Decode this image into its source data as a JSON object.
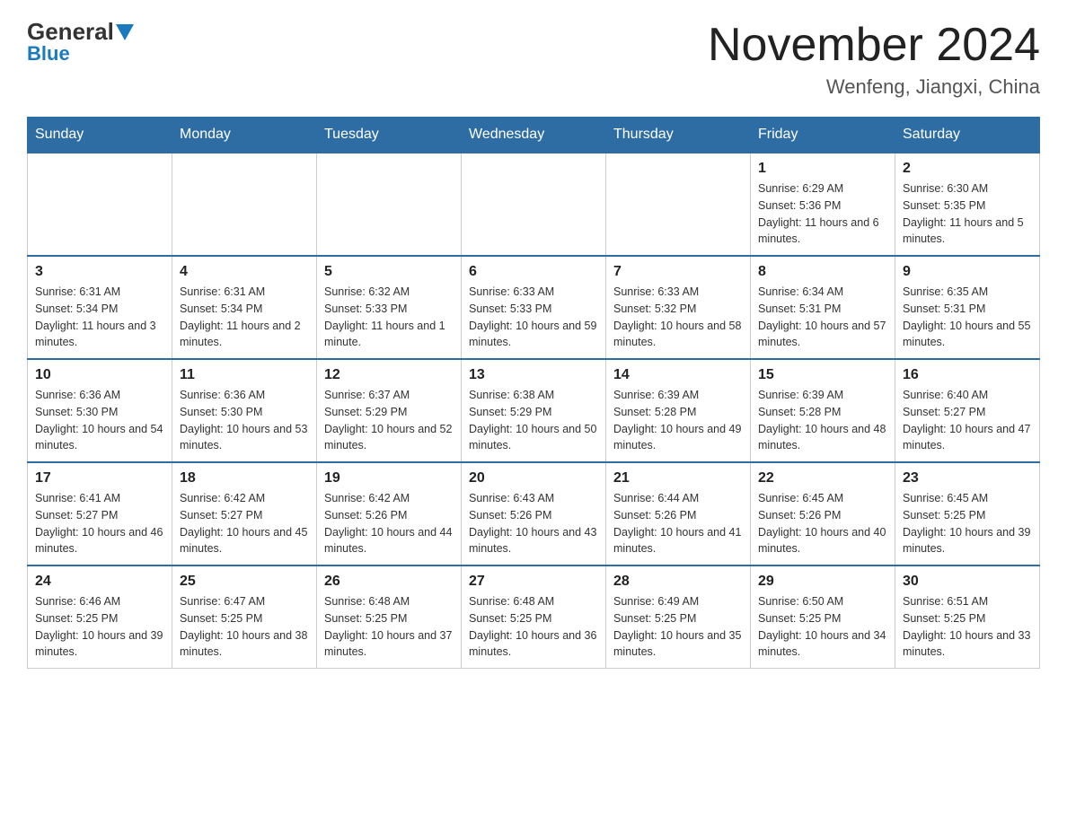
{
  "header": {
    "logo_general": "General",
    "logo_blue": "Blue",
    "main_title": "November 2024",
    "subtitle": "Wenfeng, Jiangxi, China"
  },
  "weekdays": [
    "Sunday",
    "Monday",
    "Tuesday",
    "Wednesday",
    "Thursday",
    "Friday",
    "Saturday"
  ],
  "weeks": [
    [
      {
        "day": "",
        "info": ""
      },
      {
        "day": "",
        "info": ""
      },
      {
        "day": "",
        "info": ""
      },
      {
        "day": "",
        "info": ""
      },
      {
        "day": "",
        "info": ""
      },
      {
        "day": "1",
        "info": "Sunrise: 6:29 AM\nSunset: 5:36 PM\nDaylight: 11 hours and 6 minutes."
      },
      {
        "day": "2",
        "info": "Sunrise: 6:30 AM\nSunset: 5:35 PM\nDaylight: 11 hours and 5 minutes."
      }
    ],
    [
      {
        "day": "3",
        "info": "Sunrise: 6:31 AM\nSunset: 5:34 PM\nDaylight: 11 hours and 3 minutes."
      },
      {
        "day": "4",
        "info": "Sunrise: 6:31 AM\nSunset: 5:34 PM\nDaylight: 11 hours and 2 minutes."
      },
      {
        "day": "5",
        "info": "Sunrise: 6:32 AM\nSunset: 5:33 PM\nDaylight: 11 hours and 1 minute."
      },
      {
        "day": "6",
        "info": "Sunrise: 6:33 AM\nSunset: 5:33 PM\nDaylight: 10 hours and 59 minutes."
      },
      {
        "day": "7",
        "info": "Sunrise: 6:33 AM\nSunset: 5:32 PM\nDaylight: 10 hours and 58 minutes."
      },
      {
        "day": "8",
        "info": "Sunrise: 6:34 AM\nSunset: 5:31 PM\nDaylight: 10 hours and 57 minutes."
      },
      {
        "day": "9",
        "info": "Sunrise: 6:35 AM\nSunset: 5:31 PM\nDaylight: 10 hours and 55 minutes."
      }
    ],
    [
      {
        "day": "10",
        "info": "Sunrise: 6:36 AM\nSunset: 5:30 PM\nDaylight: 10 hours and 54 minutes."
      },
      {
        "day": "11",
        "info": "Sunrise: 6:36 AM\nSunset: 5:30 PM\nDaylight: 10 hours and 53 minutes."
      },
      {
        "day": "12",
        "info": "Sunrise: 6:37 AM\nSunset: 5:29 PM\nDaylight: 10 hours and 52 minutes."
      },
      {
        "day": "13",
        "info": "Sunrise: 6:38 AM\nSunset: 5:29 PM\nDaylight: 10 hours and 50 minutes."
      },
      {
        "day": "14",
        "info": "Sunrise: 6:39 AM\nSunset: 5:28 PM\nDaylight: 10 hours and 49 minutes."
      },
      {
        "day": "15",
        "info": "Sunrise: 6:39 AM\nSunset: 5:28 PM\nDaylight: 10 hours and 48 minutes."
      },
      {
        "day": "16",
        "info": "Sunrise: 6:40 AM\nSunset: 5:27 PM\nDaylight: 10 hours and 47 minutes."
      }
    ],
    [
      {
        "day": "17",
        "info": "Sunrise: 6:41 AM\nSunset: 5:27 PM\nDaylight: 10 hours and 46 minutes."
      },
      {
        "day": "18",
        "info": "Sunrise: 6:42 AM\nSunset: 5:27 PM\nDaylight: 10 hours and 45 minutes."
      },
      {
        "day": "19",
        "info": "Sunrise: 6:42 AM\nSunset: 5:26 PM\nDaylight: 10 hours and 44 minutes."
      },
      {
        "day": "20",
        "info": "Sunrise: 6:43 AM\nSunset: 5:26 PM\nDaylight: 10 hours and 43 minutes."
      },
      {
        "day": "21",
        "info": "Sunrise: 6:44 AM\nSunset: 5:26 PM\nDaylight: 10 hours and 41 minutes."
      },
      {
        "day": "22",
        "info": "Sunrise: 6:45 AM\nSunset: 5:26 PM\nDaylight: 10 hours and 40 minutes."
      },
      {
        "day": "23",
        "info": "Sunrise: 6:45 AM\nSunset: 5:25 PM\nDaylight: 10 hours and 39 minutes."
      }
    ],
    [
      {
        "day": "24",
        "info": "Sunrise: 6:46 AM\nSunset: 5:25 PM\nDaylight: 10 hours and 39 minutes."
      },
      {
        "day": "25",
        "info": "Sunrise: 6:47 AM\nSunset: 5:25 PM\nDaylight: 10 hours and 38 minutes."
      },
      {
        "day": "26",
        "info": "Sunrise: 6:48 AM\nSunset: 5:25 PM\nDaylight: 10 hours and 37 minutes."
      },
      {
        "day": "27",
        "info": "Sunrise: 6:48 AM\nSunset: 5:25 PM\nDaylight: 10 hours and 36 minutes."
      },
      {
        "day": "28",
        "info": "Sunrise: 6:49 AM\nSunset: 5:25 PM\nDaylight: 10 hours and 35 minutes."
      },
      {
        "day": "29",
        "info": "Sunrise: 6:50 AM\nSunset: 5:25 PM\nDaylight: 10 hours and 34 minutes."
      },
      {
        "day": "30",
        "info": "Sunrise: 6:51 AM\nSunset: 5:25 PM\nDaylight: 10 hours and 33 minutes."
      }
    ]
  ]
}
